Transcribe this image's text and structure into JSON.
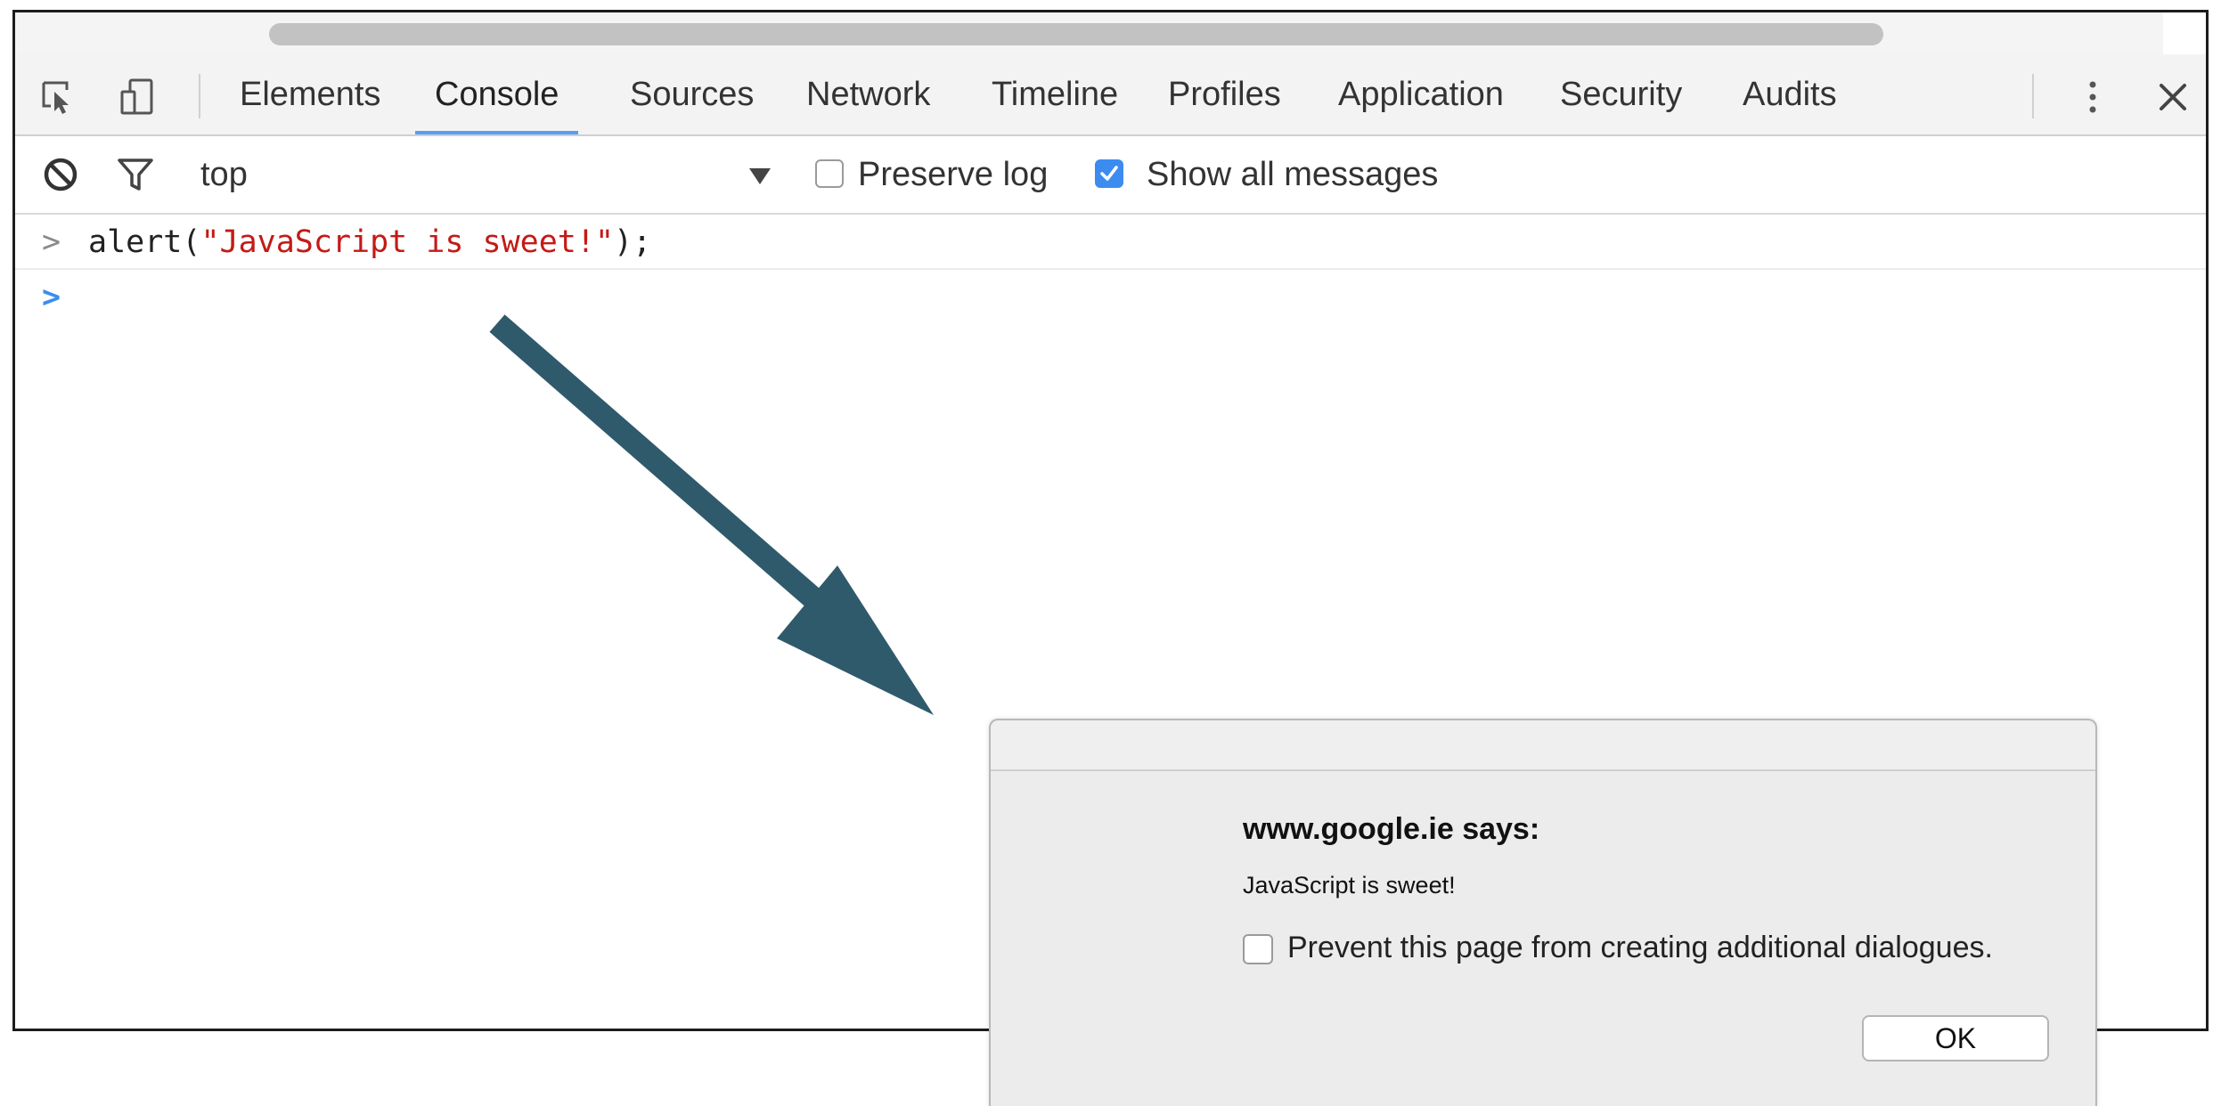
{
  "tabs": [
    {
      "label": "Elements",
      "active": false
    },
    {
      "label": "Console",
      "active": true
    },
    {
      "label": "Sources",
      "active": false
    },
    {
      "label": "Network",
      "active": false
    },
    {
      "label": "Timeline",
      "active": false
    },
    {
      "label": "Profiles",
      "active": false
    },
    {
      "label": "Application",
      "active": false
    },
    {
      "label": "Security",
      "active": false
    },
    {
      "label": "Audits",
      "active": false
    }
  ],
  "toolbar_icons": {
    "inspect": "inspect-element-icon",
    "device": "device-mode-icon",
    "more": "more-vertical-icon",
    "close": "close-icon"
  },
  "console_toolbar": {
    "clear_icon": "clear-console-icon",
    "filter_icon": "filter-icon",
    "context": "top",
    "dropdown_icon": "dropdown-triangle-icon",
    "preserve_log": {
      "label": "Preserve log",
      "checked": false
    },
    "show_all": {
      "label": "Show all messages",
      "checked": true
    }
  },
  "console": {
    "lines": [
      {
        "caret": ">",
        "code_prefix": "alert(",
        "code_string": "\"JavaScript is sweet!\"",
        "code_suffix": ");"
      }
    ],
    "prompt": ">"
  },
  "dialog": {
    "title": "www.google.ie says:",
    "message": "JavaScript is sweet!",
    "checkbox_label": "Prevent this page from creating additional dialogues.",
    "checkbox_checked": false,
    "ok_label": "OK"
  },
  "colors": {
    "active_tab_underline": "#5c9cf0",
    "string_red": "#c41a16",
    "checkbox_blue": "#3c8cf0",
    "arrow": "#2f5a6b"
  }
}
